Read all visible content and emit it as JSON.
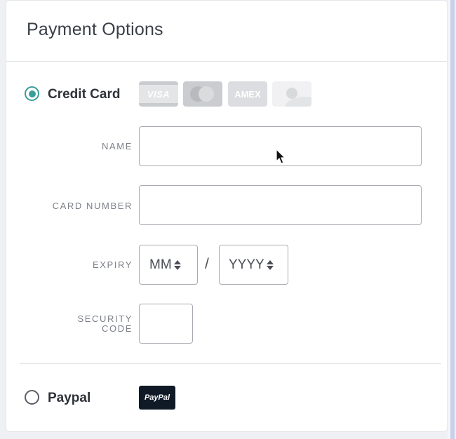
{
  "header": {
    "title": "Payment Options"
  },
  "credit_card": {
    "label": "Credit Card",
    "selected": true,
    "logos": [
      {
        "name": "visa-logo",
        "text": "VISA"
      },
      {
        "name": "mastercard-logo",
        "text": ""
      },
      {
        "name": "amex-logo",
        "text": "AMEX"
      },
      {
        "name": "discover-logo",
        "text": ""
      }
    ],
    "fields": {
      "name": {
        "label": "NAME",
        "value": "",
        "placeholder": ""
      },
      "card_number": {
        "label": "CARD NUMBER",
        "value": "",
        "placeholder": ""
      },
      "expiry": {
        "label": "EXPIRY",
        "month": "MM",
        "year": "YYYY",
        "separator": "/"
      },
      "security_code": {
        "label_line1": "SECURITY",
        "label_line2": "CODE",
        "value": ""
      }
    }
  },
  "paypal": {
    "label": "Paypal",
    "selected": false,
    "logo_text": "PayPal"
  },
  "colors": {
    "accent": "#3a9e9b",
    "paypal_logo_bg": "#0f1a26"
  }
}
